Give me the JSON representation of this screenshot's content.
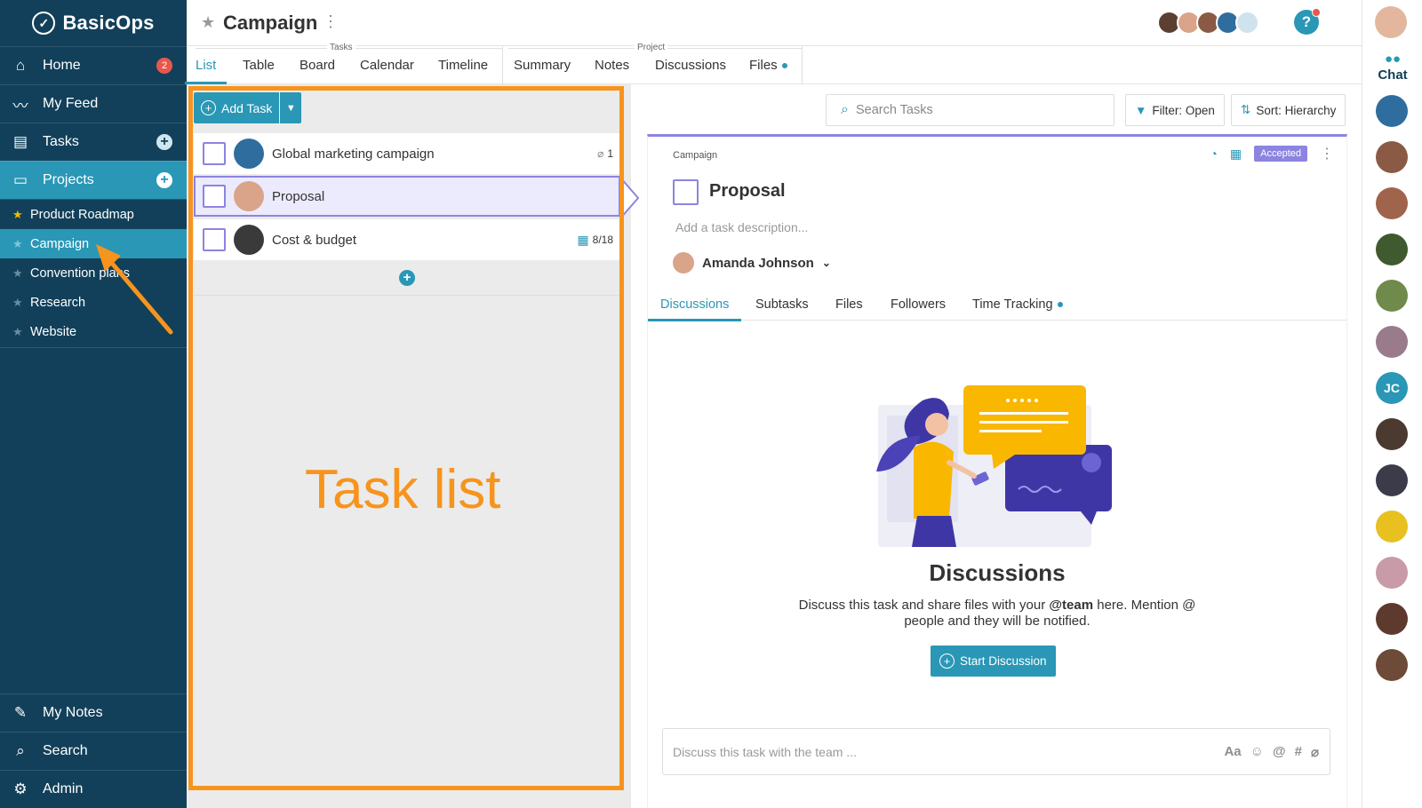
{
  "app": {
    "name": "BasicOps"
  },
  "sidebar": {
    "nav_top": [
      {
        "label": "Home",
        "icon": "home-icon",
        "badge": "2"
      },
      {
        "label": "My Feed",
        "icon": "pulse-icon"
      },
      {
        "label": "Tasks",
        "icon": "clipboard-icon"
      },
      {
        "label": "Projects",
        "icon": "folder-icon"
      }
    ],
    "projects": [
      {
        "label": "Product Roadmap",
        "favorite": true
      },
      {
        "label": "Campaign",
        "active": true
      },
      {
        "label": "Convention plans"
      },
      {
        "label": "Research"
      },
      {
        "label": "Website"
      }
    ],
    "nav_bottom": [
      {
        "label": "My Notes",
        "icon": "pencil-icon"
      },
      {
        "label": "Search",
        "icon": "search-icon"
      },
      {
        "label": "Admin",
        "icon": "gear-icon"
      }
    ]
  },
  "header": {
    "title": "Campaign"
  },
  "tabs": {
    "tasks_group": "Tasks",
    "project_group": "Project",
    "items": [
      "List",
      "Table",
      "Board",
      "Calendar",
      "Timeline",
      "Summary",
      "Notes",
      "Discussions",
      "Files"
    ]
  },
  "tasklist": {
    "add_task_label": "Add Task",
    "tasks": [
      {
        "name": "Global marketing campaign",
        "meta": "1",
        "meta_icon": "paperclip-icon"
      },
      {
        "name": "Proposal",
        "selected": true
      },
      {
        "name": "Cost & budget",
        "meta": "8/18",
        "meta_icon": "calendar-icon"
      }
    ],
    "annotation": "Task list"
  },
  "toolbar": {
    "search_placeholder": "Search Tasks",
    "filter_label": "Filter: Open",
    "sort_label": "Sort: Hierarchy"
  },
  "detail": {
    "breadcrumb": "Campaign",
    "status": "Accepted",
    "title": "Proposal",
    "description_placeholder": "Add a task description...",
    "assignee": "Amanda Johnson",
    "tabs": [
      "Discussions",
      "Subtasks",
      "Files",
      "Followers",
      "Time Tracking"
    ],
    "empty_title": "Discussions",
    "empty_text_1": "Discuss this task and share files with your",
    "empty_text_mention": "@team",
    "empty_text_2": "here. Mention @ people and they will be notified.",
    "start_button": "Start Discussion",
    "composer_placeholder": "Discuss this task with the team ...",
    "composer_tools": [
      "Aa",
      "☺",
      "@",
      "#"
    ]
  },
  "rail": {
    "chat_label": "Chat",
    "initials_avatar": "JC"
  },
  "colors": {
    "sidebar": "#12405a",
    "accent": "#2a97b6",
    "purple": "#8c84e0",
    "annotation": "#f7941d",
    "badge": "#e8574d"
  }
}
